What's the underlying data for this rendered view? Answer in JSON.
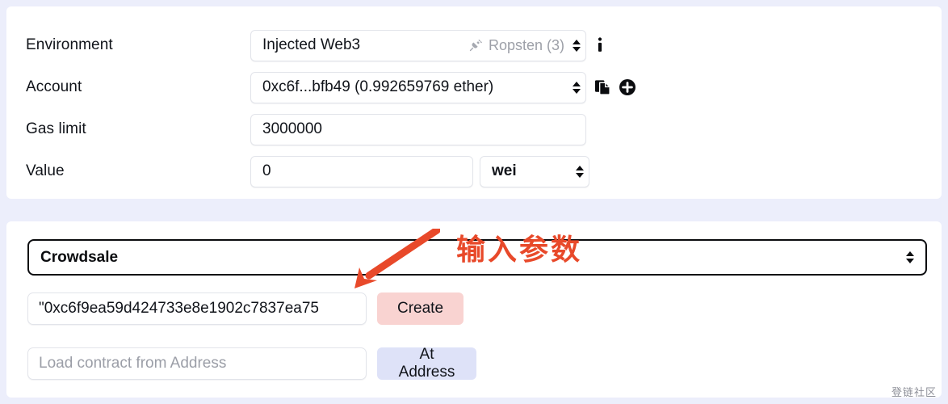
{
  "colors": {
    "page_background": "#eceefb",
    "panel_background": "#ffffff",
    "annotation": "#e8492a",
    "create_button": "#f9d3d1",
    "at_address_button": "#dee2f8",
    "text": "#11141a",
    "placeholder": "#9b9ea7"
  },
  "deploy_panel": {
    "environment": {
      "label": "Environment",
      "value": "Injected Web3",
      "network": "Ropsten (3)",
      "plug_icon": "plug-icon",
      "info_icon": "info-icon",
      "spinner_icon": "spinner-up-down-icon"
    },
    "account": {
      "label": "Account",
      "value": "0xc6f...bfb49 (0.992659769 ether)",
      "copy_icon": "copy-icon",
      "add_icon": "plus-circle-icon",
      "spinner_icon": "spinner-up-down-icon"
    },
    "gas_limit": {
      "label": "Gas limit",
      "value": "3000000"
    },
    "value": {
      "label": "Value",
      "value": "0",
      "unit": "wei",
      "spinner_icon": "spinner-up-down-icon"
    }
  },
  "contract_panel": {
    "selected_contract": "Crowdsale",
    "spinner_icon": "spinner-up-down-icon",
    "constructor_args": {
      "value": "\"0xc6f9ea59d424733e8e1902c7837ea75",
      "placeholder": ""
    },
    "create_label": "Create",
    "at_address": {
      "value": "",
      "placeholder": "Load contract from Address"
    },
    "at_address_label": "At Address"
  },
  "annotation": {
    "text": "输入参数",
    "arrow": "arrow-pointing-down-left"
  },
  "watermark": "登链社区"
}
